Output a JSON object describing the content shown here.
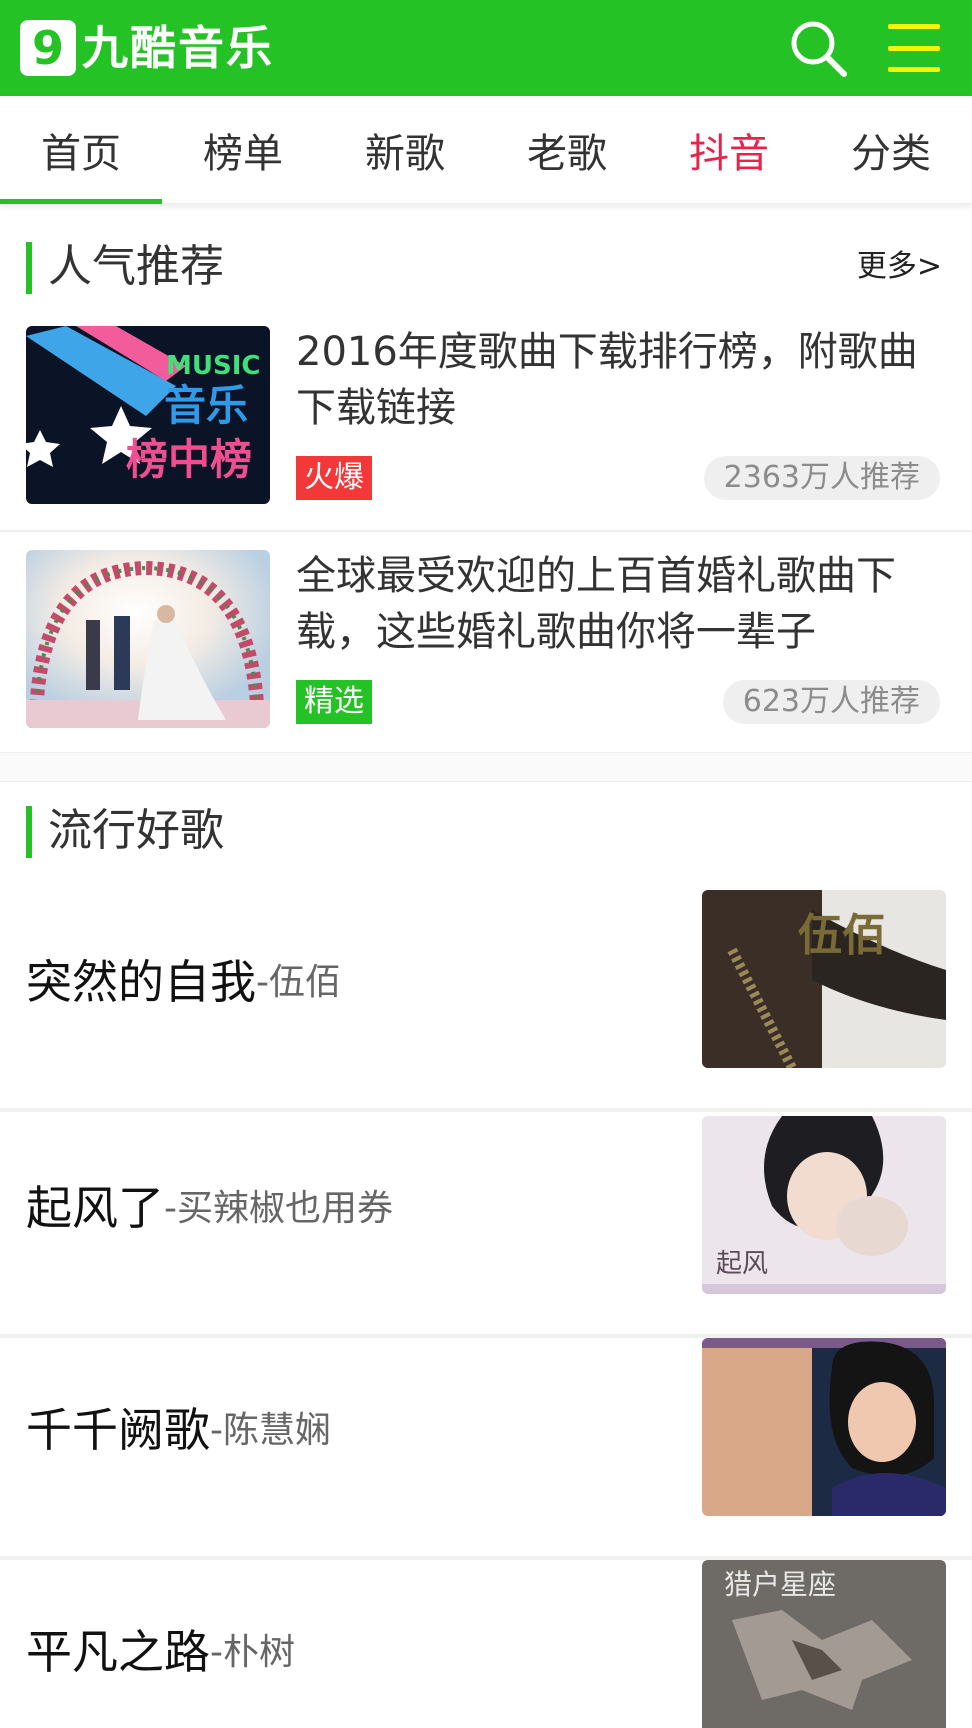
{
  "header": {
    "logo_mark": "9",
    "logo_text": "九酷音乐",
    "brand_color": "#24c224",
    "search_icon": "search-icon",
    "menu_icon": "hamburger-menu-icon"
  },
  "tabs": [
    {
      "label": "首页",
      "active": true
    },
    {
      "label": "榜单"
    },
    {
      "label": "新歌"
    },
    {
      "label": "老歌"
    },
    {
      "label": "抖音",
      "highlight_color": "#e8234a"
    },
    {
      "label": "分类"
    }
  ],
  "recommend": {
    "title": "人气推荐",
    "more_label": "更多>",
    "items": [
      {
        "title": "2016年度歌曲下载排行榜，附歌曲下载链接",
        "tag": "火爆",
        "tag_color": "#f23838",
        "count": "2363万人推荐",
        "thumb_text_1": "MUSIC",
        "thumb_text_2": "音乐",
        "thumb_text_3": "榜中榜"
      },
      {
        "title": "全球最受欢迎的上百首婚礼歌曲下载，这些婚礼歌曲你将一辈子",
        "tag": "精选",
        "tag_color": "#24c224",
        "count": "623万人推荐"
      }
    ]
  },
  "popular": {
    "title": "流行好歌",
    "songs": [
      {
        "name": "突然的自我",
        "artist": "-伍佰",
        "cover_text": "伍佰"
      },
      {
        "name": "起风了",
        "artist": "-买辣椒也用券",
        "cover_text": "起风"
      },
      {
        "name": "千千阙歌",
        "artist": "-陈慧娴"
      },
      {
        "name": "平凡之路",
        "artist": "-朴树",
        "cover_text": "猎户星座"
      }
    ]
  }
}
